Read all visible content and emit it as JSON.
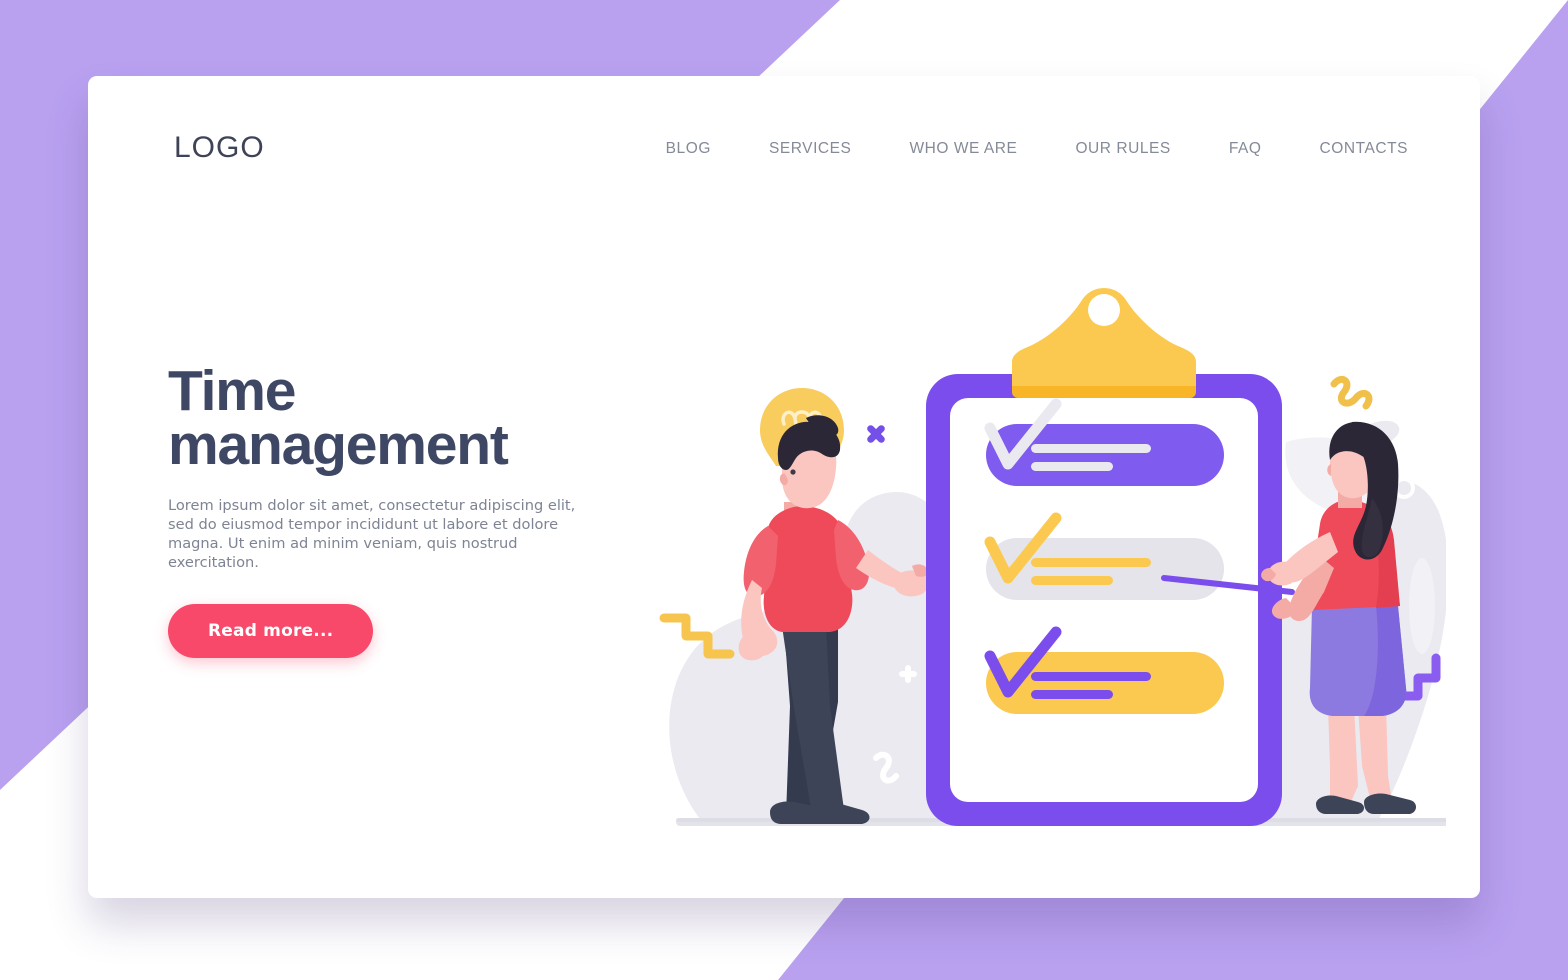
{
  "background": {
    "accent_color": "#b9a1f0",
    "card_color": "#ffffff"
  },
  "header": {
    "logo": "LOGO",
    "nav": [
      {
        "label": "BLOG",
        "name": "nav-blog"
      },
      {
        "label": "SERVICES",
        "name": "nav-services"
      },
      {
        "label": "WHO WE ARE",
        "name": "nav-who-we-are"
      },
      {
        "label": "OUR RULES",
        "name": "nav-our-rules"
      },
      {
        "label": "FAQ",
        "name": "nav-faq"
      },
      {
        "label": "CONTACTS",
        "name": "nav-contacts"
      }
    ],
    "nav_color": "#848a97",
    "logo_color": "#3e4357"
  },
  "hero": {
    "headline_line1": "Time",
    "headline_line2": "management",
    "headline_color": "#3e4763",
    "paragraph": "Lorem ipsum dolor sit amet, consectetur adipiscing elit, sed do eiusmod tempor incididunt ut labore et dolore magna. Ut enim ad minim veniam, quis nostrud exercitation.",
    "paragraph_color": "#7e8494",
    "cta_label": "Read more...",
    "cta_color": "#f8496b"
  },
  "illustration": {
    "name": "time-management-illustration",
    "clipboard": {
      "frame_color": "#7c4ded",
      "clip_color": "#fbc94f",
      "clip_shadow_color": "#f9b528",
      "paper_color": "#ffffff",
      "checklist": [
        {
          "pill_color": "#7f5bf0",
          "mark_color": "#e9e9ef",
          "line_color": "#e9e9ef",
          "state": "checked-purple"
        },
        {
          "pill_color": "#e4e4ea",
          "mark_color": "#fbc94f",
          "line_color": "#fbc94f",
          "state": "checked-yellow"
        },
        {
          "pill_color": "#fbc94f",
          "mark_color": "#7c4ded",
          "line_color": "#7c4ded",
          "state": "checked-purple-on-yellow"
        }
      ]
    },
    "characters": [
      {
        "name": "man-with-idea",
        "shirt_color": "#ef4a5a",
        "pants_color": "#3d4457",
        "skin_color": "#fbc5c0",
        "hair_color": "#2b2736",
        "shoe_color": "#3d4457",
        "accessory": "lightbulb"
      },
      {
        "name": "woman-with-pointer",
        "top_color": "#ef4a5a",
        "skirt_color": "#8d7ae0",
        "skin_color": "#fbc5c0",
        "hair_color": "#2b2736",
        "shoe_color": "#3d4457",
        "accessory": "pointer-stick"
      }
    ],
    "decorations": [
      {
        "name": "lightbulb-icon",
        "color": "#fbc94f"
      },
      {
        "name": "cross-x-icon",
        "color": "#7c4ded"
      },
      {
        "name": "plus-icon-left",
        "color": "#ffffff"
      },
      {
        "name": "plus-icon-right",
        "color": "#ffffff"
      },
      {
        "name": "zigzag-yellow-left",
        "color": "#fbc94f"
      },
      {
        "name": "zigzag-yellow-right",
        "color": "#fbc94f"
      },
      {
        "name": "zigzag-purple-right",
        "color": "#7c4ded"
      },
      {
        "name": "squiggle-white",
        "color": "#ffffff"
      },
      {
        "name": "circle-outline-white",
        "color": "#ffffff"
      },
      {
        "name": "blob-background",
        "color": "#e8e8ee"
      },
      {
        "name": "ground-line",
        "color": "#e4e4ea"
      }
    ]
  }
}
